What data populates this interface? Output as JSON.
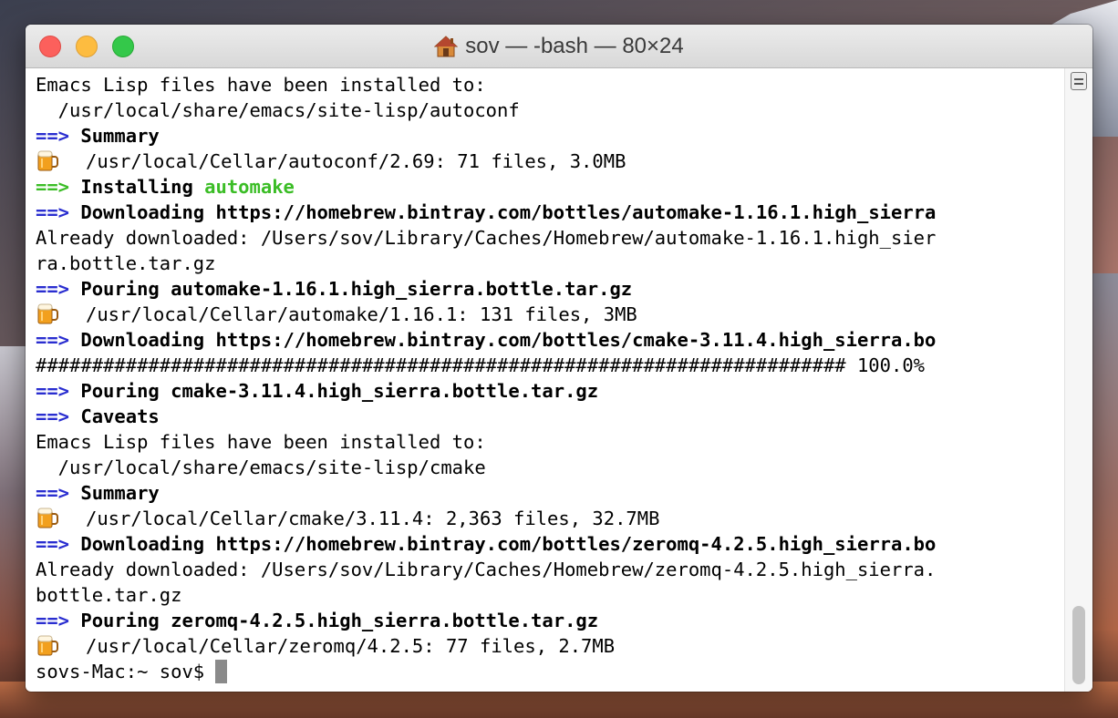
{
  "window": {
    "title": "sov — -bash — 80×24",
    "title_icon": "home-icon",
    "buttons": [
      "close",
      "minimize",
      "zoom"
    ]
  },
  "colors": {
    "arrow": "#2a2ed0",
    "green": "#3bbd26",
    "close": "#fc605c",
    "minimize": "#fdbc40",
    "zoom": "#34c84a"
  },
  "terminal": {
    "lines": [
      {
        "text": "Emacs Lisp files have been installed to:"
      },
      {
        "text": "  /usr/local/share/emacs/site-lisp/autoconf"
      },
      {
        "arrow": "==>",
        "bold": " Summary"
      },
      {
        "icon": "beer-icon",
        "text": "/usr/local/Cellar/autoconf/2.69: 71 files, 3.0MB"
      },
      {
        "arrow_green": "==>",
        "bold": " Installing ",
        "green": "automake"
      },
      {
        "arrow": "==>",
        "bold": " Downloading https://homebrew.bintray.com/bottles/automake-1.16.1.high_sierra"
      },
      {
        "text": "Already downloaded: /Users/sov/Library/Caches/Homebrew/automake-1.16.1.high_sier"
      },
      {
        "text": "ra.bottle.tar.gz"
      },
      {
        "arrow": "==>",
        "bold": " Pouring automake-1.16.1.high_sierra.bottle.tar.gz"
      },
      {
        "icon": "beer-icon",
        "text": "/usr/local/Cellar/automake/1.16.1: 131 files, 3MB"
      },
      {
        "arrow": "==>",
        "bold": " Downloading https://homebrew.bintray.com/bottles/cmake-3.11.4.high_sierra.bo"
      },
      {
        "text": "######################################################################## 100.0%"
      },
      {
        "arrow": "==>",
        "bold": " Pouring cmake-3.11.4.high_sierra.bottle.tar.gz"
      },
      {
        "arrow": "==>",
        "bold": " Caveats"
      },
      {
        "text": "Emacs Lisp files have been installed to:"
      },
      {
        "text": "  /usr/local/share/emacs/site-lisp/cmake"
      },
      {
        "arrow": "==>",
        "bold": " Summary"
      },
      {
        "icon": "beer-icon",
        "text": "/usr/local/Cellar/cmake/3.11.4: 2,363 files, 32.7MB"
      },
      {
        "arrow": "==>",
        "bold": " Downloading https://homebrew.bintray.com/bottles/zeromq-4.2.5.high_sierra.bo"
      },
      {
        "text": "Already downloaded: /Users/sov/Library/Caches/Homebrew/zeromq-4.2.5.high_sierra."
      },
      {
        "text": "bottle.tar.gz"
      },
      {
        "arrow": "==>",
        "bold": " Pouring zeromq-4.2.5.high_sierra.bottle.tar.gz"
      },
      {
        "icon": "beer-icon",
        "text": "/usr/local/Cellar/zeromq/4.2.5: 77 files, 2.7MB"
      }
    ],
    "prompt": "sovs-Mac:~ sov$ "
  }
}
